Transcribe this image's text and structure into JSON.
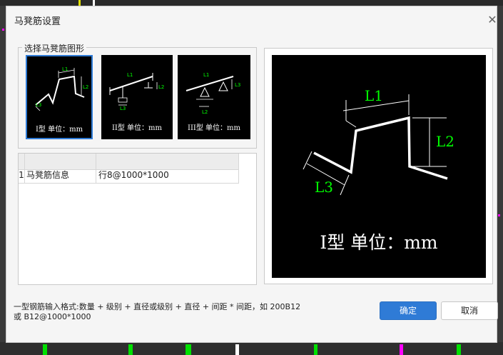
{
  "dialog": {
    "title": "马凳筋设置",
    "close_icon": "close-icon"
  },
  "shape_group": {
    "label": "选择马凳筋图形",
    "items": [
      {
        "caption": "I型 单位：mm",
        "selected": true
      },
      {
        "caption": "II型 单位：mm",
        "selected": false
      },
      {
        "caption": "III型 单位：mm",
        "selected": false
      }
    ]
  },
  "dims": {
    "l1": "L1",
    "l2": "L2",
    "l3": "L3"
  },
  "grid": {
    "rows": [
      {
        "index": "1",
        "name": "马凳筋信息",
        "value": "⾏8@1000*1000"
      }
    ]
  },
  "preview": {
    "caption": "I型 单位：mm"
  },
  "hint": {
    "line1": "一型钢筋输入格式:数量 + 级别 + 直径或级别 + 直径 + 间距 * 间距，如 200B12",
    "line2": "或 B12@1000*1000"
  },
  "buttons": {
    "ok": "确定",
    "cancel": "取消"
  },
  "colors": {
    "accent": "#2f7bd6",
    "dim_green": "#00ff00",
    "canvas_bg": "#000000"
  }
}
